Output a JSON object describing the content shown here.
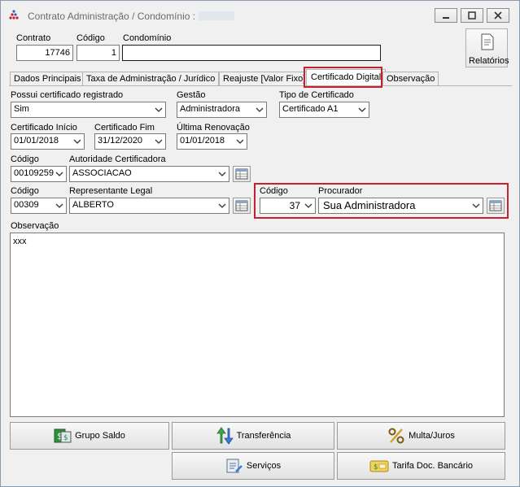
{
  "window": {
    "title": "Contrato Administração / Condomínio :",
    "controls": [
      "minimize",
      "maximize",
      "close"
    ]
  },
  "header": {
    "contrato_label": "Contrato",
    "contrato_value": "17746",
    "codigo_label": "Código",
    "codigo_value": "1",
    "condominio_label": "Condomínio",
    "condominio_value": "",
    "relatorios_label": "Relatórios"
  },
  "tabs": [
    {
      "label": "Dados Principais"
    },
    {
      "label": "Taxa de Administração / Jurídico"
    },
    {
      "label": "Reajuste [Valor Fixo]"
    },
    {
      "label": "Certificado Digital"
    },
    {
      "label": "Observação"
    }
  ],
  "form": {
    "possui_label": "Possui certificado registrado",
    "possui_value": "Sim",
    "gestao_label": "Gestão",
    "gestao_value": "Administradora",
    "tipo_label": "Tipo de Certificado",
    "tipo_value": "Certificado A1",
    "inicio_label": "Certificado Início",
    "inicio_value": "01/01/2018",
    "fim_label": "Certificado Fim",
    "fim_value": "31/12/2020",
    "renovacao_label": "Última Renovação",
    "renovacao_value": "01/01/2018",
    "autoridade_codigo_label": "Código",
    "autoridade_codigo_value": "00109259",
    "autoridade_label": "Autoridade Certificadora",
    "autoridade_value": "ASSOCIACAO",
    "representante_codigo_label": "Código",
    "representante_codigo_value": "00309",
    "representante_label": "Representante Legal",
    "representante_value": "ALBERTO",
    "procurador_codigo_label": "Código",
    "procurador_codigo_value": "37",
    "procurador_label": "Procurador",
    "procurador_value": "Sua Administradora",
    "observacao_label": "Observação",
    "observacao_value": "xxx"
  },
  "buttons": {
    "grupo_saldo": "Grupo Saldo",
    "transferencia": "Transferência",
    "multa_juros": "Multa/Juros",
    "servicos": "Serviços",
    "tarifa": "Tarifa Doc. Bancário"
  },
  "colors": {
    "highlight": "#c8202f",
    "window_bg": "#f0f0f0"
  }
}
